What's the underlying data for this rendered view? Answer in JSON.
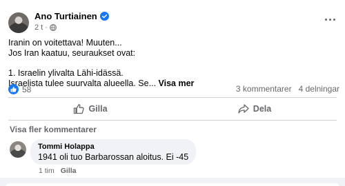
{
  "post": {
    "author": "Ano Turtiainen",
    "time": "2 t",
    "body_lines": [
      "Iranin on voitettava! Muuten...",
      "Jos Iran kaatuu, seuraukset ovat:",
      "1. Israelin ylivalta Lähi-idässä.",
      "Israelista tulee suurvalta alueella. Se..."
    ],
    "see_more": "Visa mer",
    "reaction_count": "58",
    "comments_count": "3 kommentarer",
    "shares_count": "4 delningar"
  },
  "actions": {
    "like": "Gilla",
    "share": "Dela"
  },
  "comments": {
    "view_more": "Visa fler kommentarer",
    "items": [
      {
        "author": "Tommi Holappa",
        "text": "1941 oli tuo Barbarossan aloitus. Ei -45",
        "time": "1 tim",
        "like": "Gilla"
      }
    ]
  },
  "colors": {
    "accent": "#1877f2",
    "secondary_text": "#65676b",
    "bubble": "#f0f2f5"
  },
  "icons": [
    "verified-badge-icon",
    "globe-icon",
    "more-options-icon",
    "like-reaction-icon",
    "thumbs-up-icon",
    "share-icon"
  ]
}
